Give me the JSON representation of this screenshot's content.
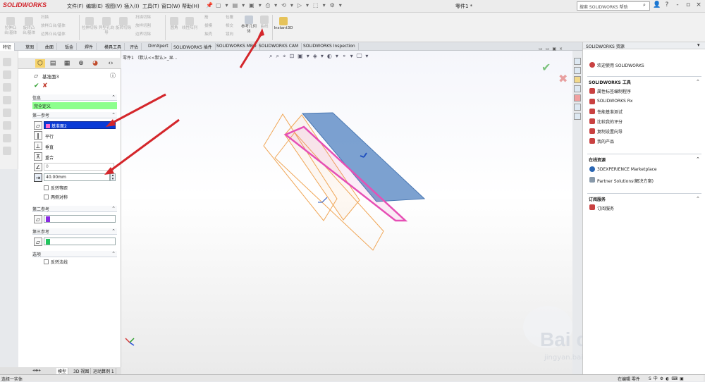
{
  "app": {
    "logo": "SOLIDWORKS",
    "menus": [
      "文件(F)",
      "编辑(E)",
      "视图(V)",
      "插入(I)",
      "工具(T)",
      "窗口(W)",
      "帮助(H)"
    ],
    "doc_title": "零件1 *",
    "help_search": "搜索 SOLIDWORKS 帮助",
    "window_controls": [
      "?",
      "-",
      "▫",
      "×"
    ]
  },
  "ribbon": {
    "big_buttons": [
      "拉伸凸台/基体",
      "旋转凸台/基体"
    ],
    "small_left": [
      "扫描",
      "放样凸台/基体",
      "边界凸台/基体"
    ],
    "cut_buttons": [
      "拉伸切除",
      "异型孔向导",
      "旋转切除"
    ],
    "cut_small": [
      "扫描切除",
      "放样切割",
      "边界切除"
    ],
    "feature_buttons": [
      "圆角",
      "线性阵列"
    ],
    "feature_small": [
      "筋",
      "拔模",
      "抽壳",
      "包覆",
      "相交",
      "镜向"
    ],
    "ref_geom": "参考几何体",
    "curves": "曲线",
    "instant3d": "Instant3D"
  },
  "tabs": [
    "特征",
    "草图",
    "曲面",
    "钣金",
    "焊件",
    "模具工具",
    "评估",
    "DimXpert",
    "SOLIDWORKS 插件",
    "SOLIDWORKS MBD",
    "SOLIDWORKS CAM",
    "SOLIDWORKS Inspection"
  ],
  "breadcrumb": "零件1 （默认<<默认>_显...",
  "property_manager": {
    "title": "基准面3",
    "message_header": "信息",
    "message": "完全定义",
    "first_ref": {
      "header": "第一参考",
      "value": "基准面2",
      "options": [
        "平行",
        "垂直",
        "重合"
      ],
      "angle": "0",
      "distance": "40.00mm",
      "flip": "反转等距",
      "mid": "两侧对称"
    },
    "second_ref": {
      "header": "第二参考"
    },
    "third_ref": {
      "header": "第三参考"
    },
    "options": {
      "header": "选项",
      "flip_normal": "反转法线"
    }
  },
  "bottom_tabs": [
    "模型",
    "3D 视图",
    "运动算例 1"
  ],
  "status": {
    "left": "选择一实体",
    "right": "在编辑 零件"
  },
  "task_pane": {
    "title": "SOLIDWORKS 资源",
    "welcome": "欢迎使用 SOLIDWORKS",
    "tools_header": "SOLIDWORKS 工具",
    "tools": [
      "属性标签编制程序",
      "SOLIDWORKS Rx",
      "性能基准测试",
      "比较我的评分",
      "复制设置向导",
      "我的产品"
    ],
    "online_header": "在线资源",
    "online": [
      "3DEXPERIENCE Marketplace",
      "Partner Solutions(解决方案)"
    ],
    "sub_header": "订阅服务",
    "sub": [
      "订阅服务"
    ]
  },
  "watermark": {
    "brand": "Bai du 经验",
    "url": "jingyan.baidu.com"
  },
  "colors": {
    "accent": "#d2232a",
    "plane_blue": "#5b8ac4",
    "plane_pink": "#e64fb5",
    "plane_orange": "#f0a656",
    "message_green": "#8dff8d"
  }
}
